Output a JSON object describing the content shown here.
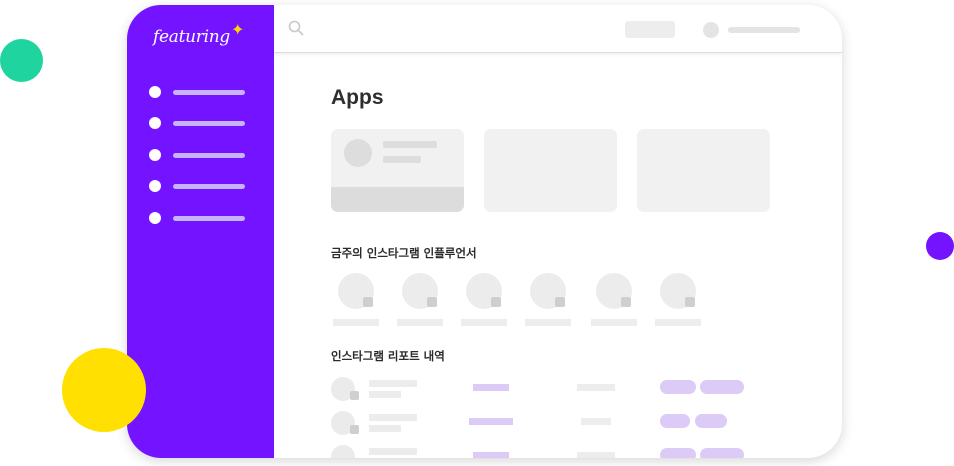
{
  "app": {
    "brand": "featuring",
    "brand_sparkle": "✦",
    "colors": {
      "sidebar": "#7413ff",
      "accent_yellow": "#ffe000",
      "accent_green": "#1fd49e",
      "accent_purple": "#7413ff",
      "placeholder": "#ececec",
      "placeholder_purple": "#dccaf7"
    }
  },
  "sidebar": {
    "items": [
      {
        "name": "nav-item-1"
      },
      {
        "name": "nav-item-2"
      },
      {
        "name": "nav-item-3"
      },
      {
        "name": "nav-item-4"
      },
      {
        "name": "nav-item-5"
      }
    ]
  },
  "topbar": {
    "search_icon": "search-icon"
  },
  "main": {
    "title": "Apps",
    "sections": [
      {
        "title": "금주의 인스타그램 인플루언서"
      },
      {
        "title": "인스타그램 리포트 내역"
      }
    ]
  }
}
